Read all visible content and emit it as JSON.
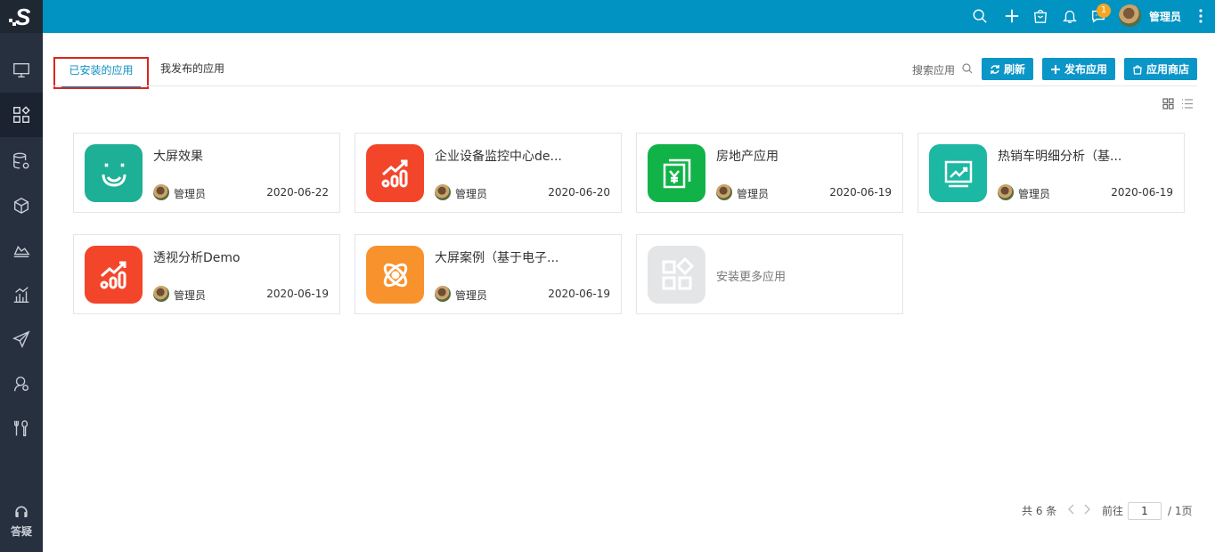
{
  "nav": {
    "logo": "S",
    "items": [
      {
        "icon": "monitor-icon"
      },
      {
        "icon": "apps-icon"
      },
      {
        "icon": "database-settings-icon"
      },
      {
        "icon": "cube-icon"
      },
      {
        "icon": "area-chart-icon"
      },
      {
        "icon": "bar-chart-icon"
      },
      {
        "icon": "send-icon"
      },
      {
        "icon": "user-settings-icon"
      },
      {
        "icon": "tools-icon"
      }
    ],
    "help_label": "答疑"
  },
  "header": {
    "notification_count": "1",
    "user_name": "管理员"
  },
  "tabs": {
    "installed": "已安装的应用",
    "published": "我发布的应用"
  },
  "toolbar": {
    "search_label": "搜索应用",
    "refresh_label": "刷新",
    "publish_label": "发布应用",
    "store_label": "应用商店"
  },
  "apps": [
    {
      "name": "大屏效果",
      "owner": "管理员",
      "date": "2020-06-22",
      "color": "#1eb096",
      "icon": "smile-face-icon"
    },
    {
      "name": "企业设备监控中心de...",
      "owner": "管理员",
      "date": "2020-06-20",
      "color": "#f3452a",
      "icon": "growth-chart-icon"
    },
    {
      "name": "房地产应用",
      "owner": "管理员",
      "date": "2020-06-19",
      "color": "#11b349",
      "icon": "yuan-document-icon"
    },
    {
      "name": "热销车明细分析（基...",
      "owner": "管理员",
      "date": "2020-06-19",
      "color": "#1cb8a3",
      "icon": "line-chart-board-icon"
    },
    {
      "name": "透视分析Demo",
      "owner": "管理员",
      "date": "2020-06-19",
      "color": "#f3452a",
      "icon": "growth-chart-icon"
    },
    {
      "name": "大屏案例（基于电子...",
      "owner": "管理员",
      "date": "2020-06-19",
      "color": "#f7922c",
      "icon": "atom-icon"
    }
  ],
  "install_more": "安装更多应用",
  "pagination": {
    "total": "共 6 条",
    "goto": "前往",
    "page": "1",
    "of": "/ 1页"
  }
}
